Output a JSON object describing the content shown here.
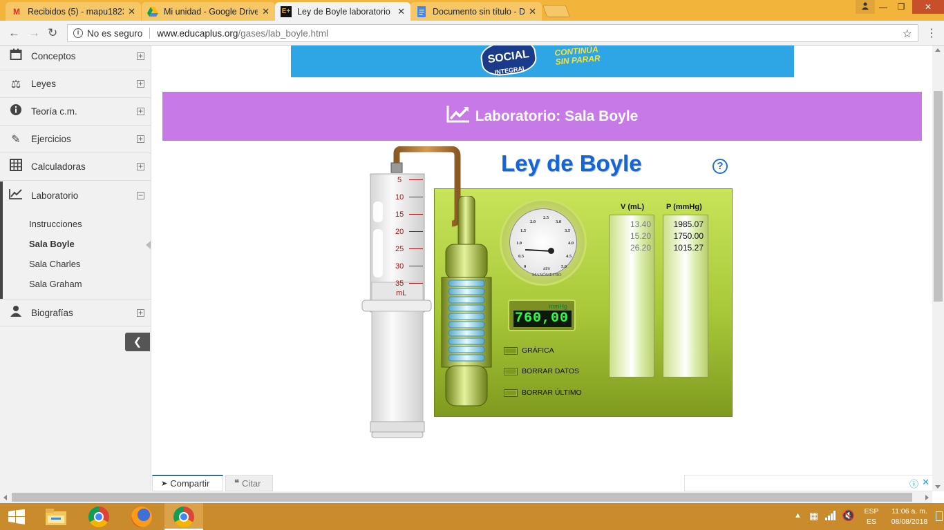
{
  "browser": {
    "tabs": [
      {
        "title": "Recibidos (5) - mapu1823",
        "favicon": "gmail-icon",
        "active": false
      },
      {
        "title": "Mi unidad - Google Drive",
        "favicon": "drive-icon",
        "active": false
      },
      {
        "title": "Ley de Boyle laboratorio",
        "favicon": "educaplus-icon",
        "active": true
      },
      {
        "title": "Documento sin título - D",
        "favicon": "docs-icon",
        "active": false
      }
    ],
    "security": "No es seguro",
    "url_host": "www.educaplus.org",
    "url_path": "/gases/lab_boyle.html"
  },
  "sidebar": {
    "items": [
      {
        "label": "Conceptos",
        "icon": "calendar-icon",
        "expanded": false
      },
      {
        "label": "Leyes",
        "icon": "scale-icon",
        "expanded": false
      },
      {
        "label": "Teoría c.m.",
        "icon": "info-icon",
        "expanded": false
      },
      {
        "label": "Ejercicios",
        "icon": "pencil-icon",
        "expanded": false
      },
      {
        "label": "Calculadoras",
        "icon": "calculator-icon",
        "expanded": false
      },
      {
        "label": "Laboratorio",
        "icon": "chart-line-icon",
        "expanded": true
      },
      {
        "label": "Biografías",
        "icon": "user-icon",
        "expanded": false
      }
    ],
    "lab_subitems": [
      "Instrucciones",
      "Sala Boyle",
      "Sala Charles",
      "Sala Graham"
    ],
    "selected_subitem": "Sala Boyle"
  },
  "ad": {
    "logo_line1": "SOCIAL",
    "logo_line2": "INTEGRAL",
    "text_line1": "CONTINÚA",
    "text_line2": "SIN PARAR"
  },
  "header": {
    "title": "Laboratorio: Sala Boyle"
  },
  "sim": {
    "title": "Ley de Boyle",
    "syringe_ticks": [
      "5",
      "10",
      "15",
      "20",
      "25",
      "30",
      "35"
    ],
    "syringe_unit": "mL",
    "gauge_numbers": [
      "0",
      "0.5",
      "1.0",
      "1.5",
      "2.0",
      "2.5",
      "3.0",
      "3.5",
      "4.0",
      "4.5",
      "5.0"
    ],
    "gauge_unit": "atm",
    "gauge_label": "MANÓMETRO",
    "gauge_value_atm": 1.0,
    "lcd_unit": "mmHg",
    "lcd_value": "760,00",
    "options": [
      "GRÁFICA",
      "BORRAR DATOS",
      "BORRAR ÚLTIMO"
    ],
    "table": {
      "v_header": "V (mL)",
      "p_header": "P (mmHg)",
      "rows": [
        {
          "v": "13.40",
          "p": "1985.07"
        },
        {
          "v": "15.20",
          "p": "1750.00"
        },
        {
          "v": "26.20",
          "p": "1015.27"
        }
      ]
    }
  },
  "footer_tabs": {
    "share": "Compartir",
    "cite": "Citar"
  },
  "taskbar": {
    "lang1": "ESP",
    "lang2": "ES",
    "time": "11:06 a. m.",
    "date": "08/08/2018"
  }
}
